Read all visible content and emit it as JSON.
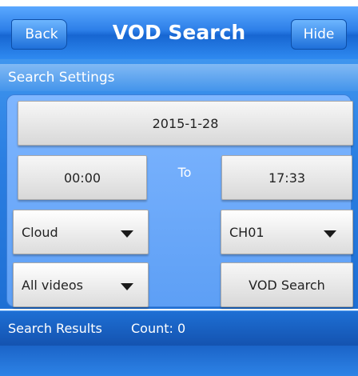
{
  "header": {
    "title": "VOD Search",
    "back_label": "Back",
    "hide_label": "Hide"
  },
  "settings": {
    "section_label": "Search Settings",
    "date": "2015-1-28",
    "start_time": "00:00",
    "to_label": "To",
    "end_time": "17:33",
    "storage_select": "Cloud",
    "channel_select": "CH01",
    "video_type_select": "All videos",
    "search_button": "VOD Search"
  },
  "results": {
    "label": "Search Results",
    "count_text": "Count:  0"
  },
  "colors": {
    "header_blue": "#2d7fe8",
    "panel_blue": "#6aa8f8",
    "button_gray": "#e0e0e0",
    "text_white": "#ffffff"
  }
}
